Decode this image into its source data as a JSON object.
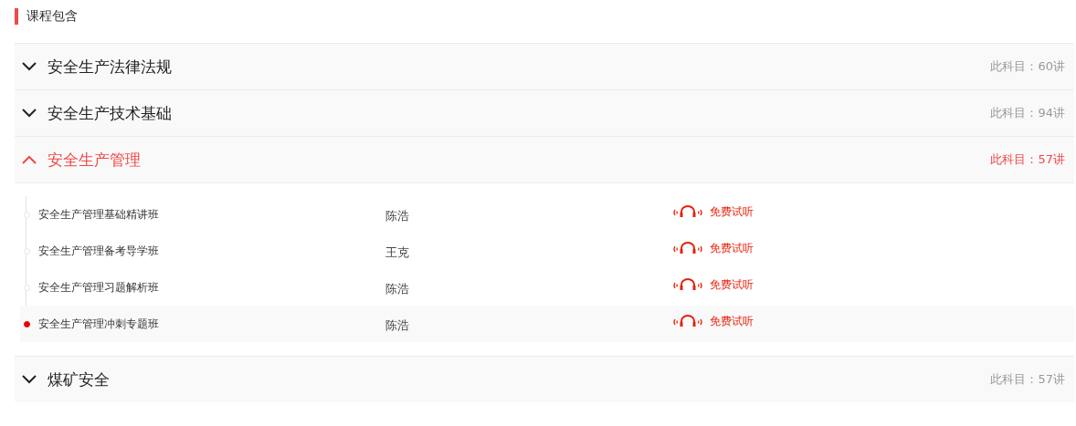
{
  "heading": "课程包含",
  "sections": [
    {
      "title": "安全生产法律法规",
      "count": "此科目：60讲",
      "expanded": false
    },
    {
      "title": "安全生产技术基础",
      "count": "此科目：94讲",
      "expanded": false
    },
    {
      "title": "安全生产管理",
      "count": "此科目：57讲",
      "expanded": true,
      "lessons": [
        {
          "title": "安全生产管理基础精讲班",
          "teacher": "陈浩",
          "action": "免费试听",
          "selected": false
        },
        {
          "title": "安全生产管理备考导学班",
          "teacher": "王克",
          "action": "免费试听",
          "selected": false
        },
        {
          "title": "安全生产管理习题解析班",
          "teacher": "陈浩",
          "action": "免费试听",
          "selected": false
        },
        {
          "title": "安全生产管理冲刺专题班",
          "teacher": "陈浩",
          "action": "免费试听",
          "selected": true
        }
      ]
    },
    {
      "title": "煤矿安全",
      "count": "此科目：57讲",
      "expanded": false
    }
  ]
}
